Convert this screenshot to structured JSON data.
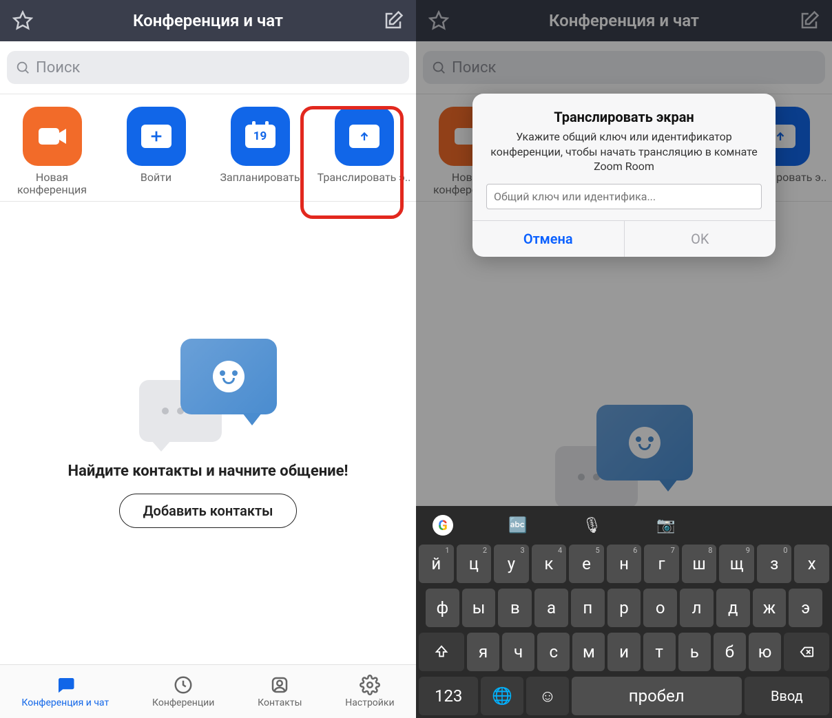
{
  "header": {
    "title": "Конференция и чат"
  },
  "search": {
    "placeholder": "Поиск"
  },
  "actions": {
    "new_meeting": "Новая конференция",
    "join": "Войти",
    "schedule": "Запланировать",
    "share_screen": "Транслировать э..",
    "calendar_day": "19"
  },
  "empty": {
    "title": "Найдите контакты и начните общение!",
    "button": "Добавить контакты"
  },
  "tabs": {
    "chat": "Конференция и чат",
    "meetings": "Конференции",
    "contacts": "Контакты",
    "settings": "Настройки"
  },
  "dialog": {
    "title": "Транслировать экран",
    "message": "Укажите общий ключ или идентификатор конференции, чтобы начать трансляцию в комнате Zoom Room",
    "placeholder": "Общий ключ или идентифика...",
    "cancel": "Отмена",
    "ok": "OK"
  },
  "keyboard": {
    "row1": [
      {
        "c": "й",
        "s": "1"
      },
      {
        "c": "ц",
        "s": "2"
      },
      {
        "c": "у",
        "s": "3"
      },
      {
        "c": "к",
        "s": "4"
      },
      {
        "c": "е",
        "s": "5"
      },
      {
        "c": "н",
        "s": "6"
      },
      {
        "c": "г",
        "s": "7"
      },
      {
        "c": "ш",
        "s": "8"
      },
      {
        "c": "щ",
        "s": "9"
      },
      {
        "c": "з",
        "s": "0"
      },
      {
        "c": "х",
        "s": ""
      }
    ],
    "row2": [
      "ф",
      "ы",
      "в",
      "а",
      "п",
      "р",
      "о",
      "л",
      "д",
      "ж",
      "э"
    ],
    "row3": [
      "я",
      "ч",
      "с",
      "м",
      "и",
      "т",
      "ь",
      "б",
      "ю"
    ],
    "numeric": "123",
    "space": "пробел",
    "enter": "Ввод"
  }
}
